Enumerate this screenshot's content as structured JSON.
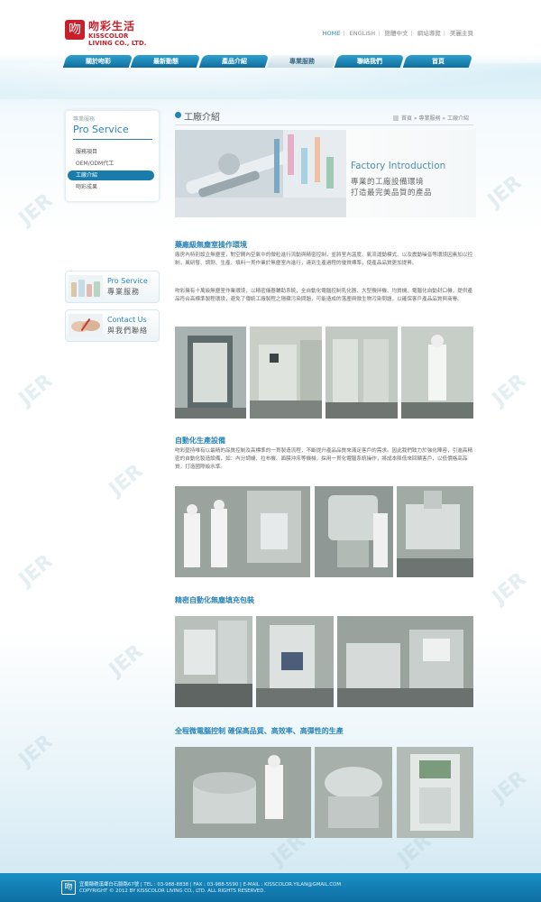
{
  "header": {
    "logo_mark": "吻",
    "brand_cn": "吻彩生活",
    "brand_en1": "KISSCOLOR",
    "brand_en2": "LIVING CO., LTD.",
    "top_links": [
      "HOME",
      "ENGLISH",
      "簡體中文",
      "網站導覽",
      "美麗主頁"
    ]
  },
  "nav": {
    "items": [
      "關於吻彩",
      "最新動態",
      "產品介紹",
      "專業服務",
      "聯絡我們",
      "首頁"
    ],
    "active_index": 3
  },
  "sidebar": {
    "caption": "專業服務",
    "title": "Pro Service",
    "items": [
      "服務項目",
      "OEM/ODM代工",
      "工廠介紹",
      "吻彩成果"
    ],
    "active_index": 2,
    "promo1": {
      "en": "Pro Service",
      "cn": "專業服務"
    },
    "promo2": {
      "en": "Contact Us",
      "cn": "與我們聯絡"
    }
  },
  "main": {
    "page_title": "工廠介紹",
    "breadcrumb": "首頁 » 專業服務 » 工廠介紹",
    "banner": {
      "en": "Factory Introduction",
      "cn1": "專業的工廠設備環境",
      "cn2": "打造最完美品質的產品"
    },
    "sections": [
      {
        "title": "藥廠級無塵室操作環境",
        "paragraphs": [
          "廠房內特別設立無塵室，對空間內空氣中的微粒進行流動與精密控制，並將室內溫度、氣流運動模式、以及震動噪音等環境因素加以控制，風研發、調劑、生產、填料一貫作業於無塵室內進行，達到生產過程的優質標準，使產品品質更加提昇。",
          "吻彩擁有十萬級無塵室作業環境，以精密儀器輔助系統，全自動化電腦控制乳化器、大型攪拌機、均質機、電腦化自動封口機，提供產品符合高標準製程環境，避免了傳統工廠製程之隱藏污染問題，可能造成的落塵與微生物污染問題，以確保客戶產品品質與商譽。"
        ]
      },
      {
        "title": "自動化生產設備",
        "paragraphs": [
          "吻彩堅持唯有以最精的品質控制及高標準的一貫製造流程，不斷提升產品品質來滿足客戶的需求。因此我們致力於強化陣容，引進高精密的自動化製造設備，如：內分調機、拉布機、面膜沖床等機械，採用一貫化電腦系統操作，將成本降低來回饋客戶，以低價格高品質，打造國際級水準。"
        ]
      },
      {
        "title": "精密自動化無塵填充包裝",
        "paragraphs": []
      },
      {
        "title": "全程微電腦控制  確保高品質、高效率、高彈性的生產",
        "paragraphs": []
      }
    ]
  },
  "footer": {
    "logo": "吻",
    "line1": "宜蘭縣礁溪鄉白石腳路67號 | TEL : 03-988-8838 | FAX : 03-988-5590 | E-MAIL : KISSCOLOR.YILAN@GMAIL.COM",
    "line2": "COPYRIGHT © 2012 BY KISSCOLOR LIVING CO., LTD. ALL RIGHTS RESERVED."
  },
  "watermark": "JER",
  "colors": {
    "accent": "#2a84b8",
    "nav": "#1a7cab",
    "brand": "#c8202a"
  }
}
